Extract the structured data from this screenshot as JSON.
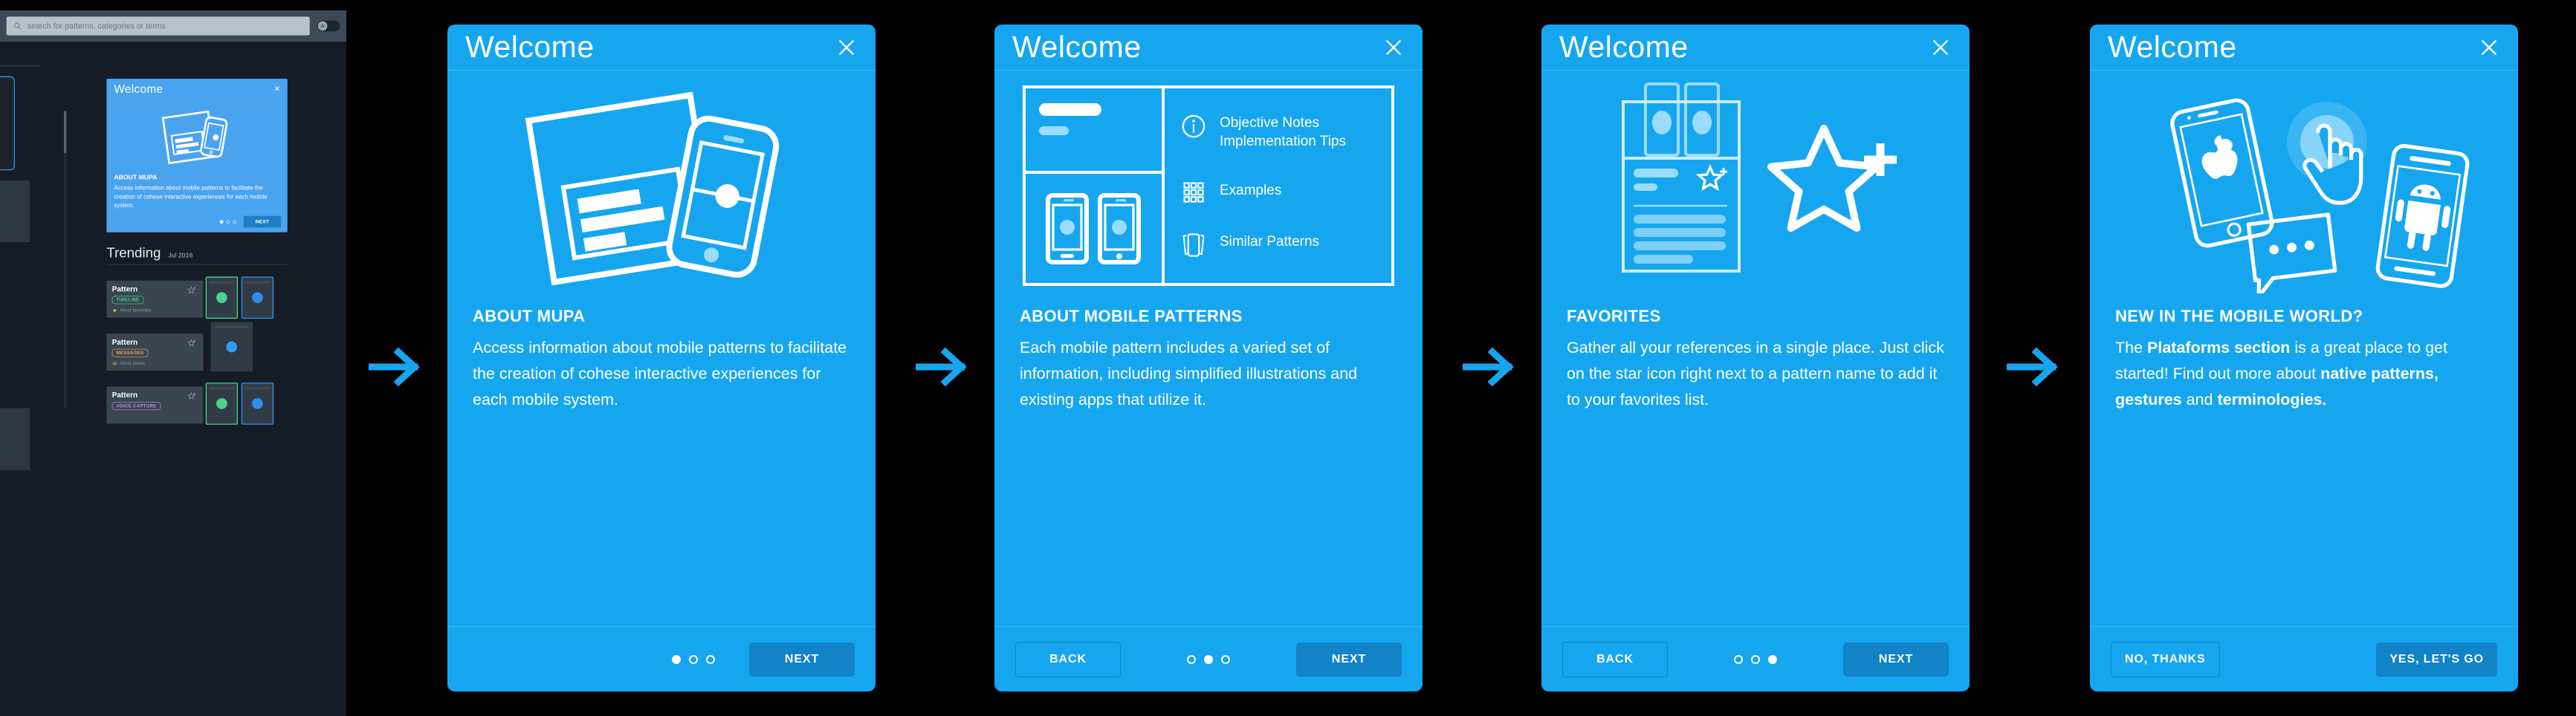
{
  "app": {
    "search": {
      "placeholder": "search for patterns, categories or terms",
      "icon": "search-icon"
    },
    "toggle": {
      "label": "A",
      "icon": "theme-toggle"
    },
    "trending": {
      "title": "Trending",
      "date": "Jul 2016"
    },
    "patterns": [
      {
        "name": "Pattern",
        "tag": "TIMELINE",
        "tag_color": "#4bd18a",
        "meta": "Most favorites",
        "meta_icon": "star-icon"
      },
      {
        "name": "Pattern",
        "tag": "MESSAGES",
        "tag_color": "#f0a35e",
        "meta": "Most views",
        "meta_icon": "eye-icon"
      },
      {
        "name": "Pattern",
        "tag": "VOICE CAPTURE",
        "tag_color": "#c58bf0",
        "meta": "",
        "meta_icon": ""
      }
    ],
    "mini_modal": {
      "title": "Welcome",
      "close": "×",
      "heading": "ABOUT MUPA",
      "body": "Access information about mobile patterns to facilitate the creation of cohese interactive experiences for each mobile system.",
      "next": "NEXT"
    }
  },
  "colors": {
    "card_blue": "#16a6f0",
    "primary_button": "#1183c6",
    "arrow_blue": "#16a6f0",
    "divider": "#3fb6f3",
    "app_dark": "#151c25"
  },
  "arrows": {
    "glyph": "arrow-right",
    "count": 4
  },
  "cards": [
    {
      "title": "Welcome",
      "close_label": "×",
      "illustration": "document-and-phone-illustration",
      "heading": "ABOUT MUPA",
      "body_html": "Access information about mobile patterns to facilitate the creation of cohese interactive experiences for each mobile system.",
      "dots": [
        true,
        false,
        false
      ],
      "back_label": null,
      "next_label": "NEXT"
    },
    {
      "title": "Welcome",
      "close_label": "×",
      "illustration": "pattern-detail-layout-illustration",
      "list_items": [
        {
          "icon": "info-circle-icon",
          "text": "Objective  Notes Implementation Tips"
        },
        {
          "icon": "grid-icon",
          "text": "Examples"
        },
        {
          "icon": "cards-stack-icon",
          "text": "Similar Patterns"
        }
      ],
      "heading": "ABOUT MOBILE PATTERNS",
      "body_html": "Each mobile pattern includes a varied set of information, including simplified illustrations and existing apps that utilize it.",
      "dots": [
        false,
        true,
        false
      ],
      "back_label": "BACK",
      "next_label": "NEXT"
    },
    {
      "title": "Welcome",
      "close_label": "×",
      "illustration": "pattern-page-and-star-illustration",
      "heading": "FAVORITES",
      "body_html": "Gather all your references in a single place. Just click on the star icon right next to a pattern name to add it to your favorites list.",
      "dots": [
        false,
        false,
        true
      ],
      "back_label": "BACK",
      "next_label": "NEXT"
    },
    {
      "title": "Welcome",
      "close_label": "×",
      "illustration": "platforms-devices-illustration",
      "heading": "NEW IN THE MOBILE WORLD?",
      "body_parts": [
        {
          "text": "The ",
          "bold": false
        },
        {
          "text": "Plataforms section",
          "bold": true
        },
        {
          "text": " is a great place to get started! Find out more about ",
          "bold": false
        },
        {
          "text": "native patterns, gestures",
          "bold": true
        },
        {
          "text": " and ",
          "bold": false
        },
        {
          "text": "terminologies.",
          "bold": true
        }
      ],
      "dots": null,
      "back_label": "NO, THANKS",
      "next_label": "YES, LET'S GO"
    }
  ]
}
